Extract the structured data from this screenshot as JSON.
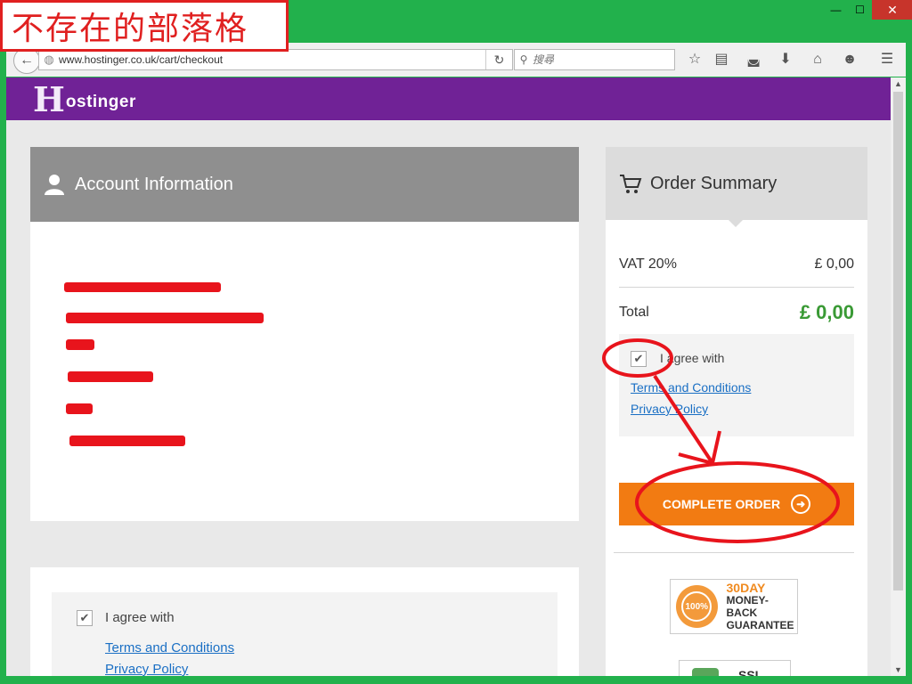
{
  "watermark": {
    "text": "不存在的部落格"
  },
  "window": {
    "minimize": "—",
    "maximize": "☐",
    "close": "✕"
  },
  "browser": {
    "url": "www.hostinger.co.uk/cart/checkout",
    "search_placeholder": "搜尋"
  },
  "site": {
    "logo_initial": "H",
    "logo_rest": "ostinger"
  },
  "account": {
    "title": "Account Information"
  },
  "summary": {
    "title": "Order Summary",
    "vat_label": "VAT 20%",
    "vat_value": "£ 0,00",
    "total_label": "Total",
    "total_value": "£ 0,00",
    "agree_text": "I agree with",
    "terms_link": "Terms and Conditions",
    "privacy_link": "Privacy Policy",
    "complete_button": "COMPLETE ORDER"
  },
  "agreement_bottom": {
    "agree_text": "I agree with",
    "terms_link": "Terms and Conditions",
    "privacy_link": "Privacy Policy"
  },
  "badges": {
    "guarantee_seal": "100%",
    "guarantee_days": "30DAY",
    "guarantee_line1": "MONEY-BACK",
    "guarantee_line2": "GUARANTEE",
    "ssl": "SSL"
  },
  "colors": {
    "header_purple": "#702296",
    "button_orange": "#f27b12",
    "total_green": "#3a9a35",
    "annotation_red": "#e8141c",
    "frame_green": "#22b14c"
  }
}
